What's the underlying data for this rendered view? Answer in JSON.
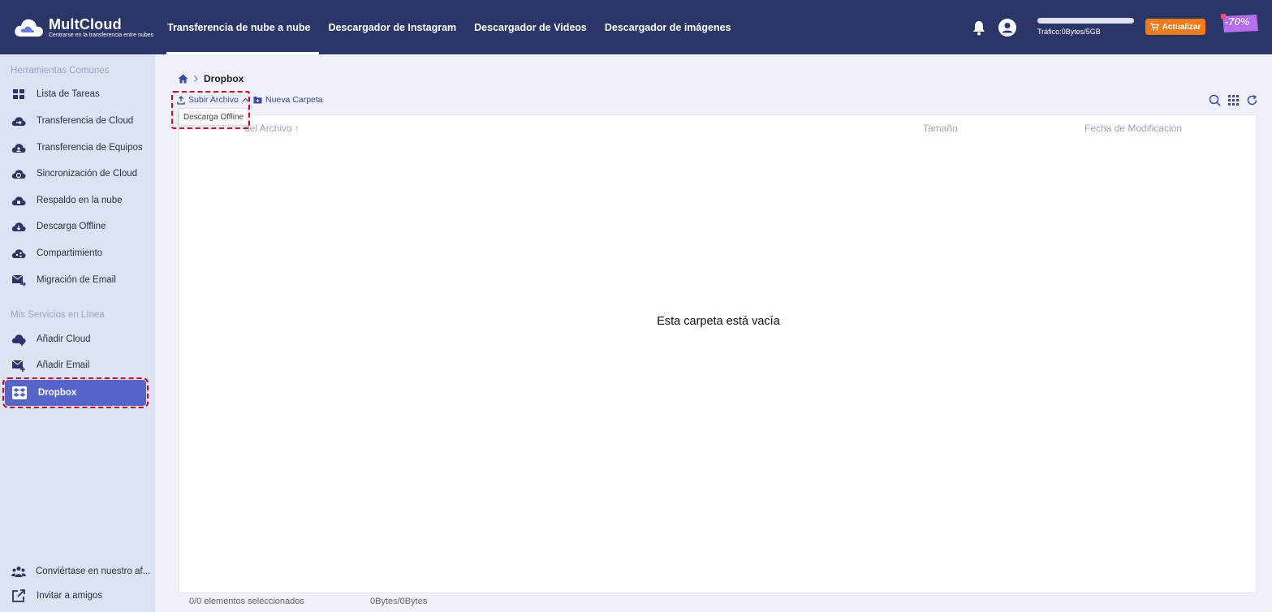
{
  "brand": {
    "name": "MultCloud",
    "tagline": "Centrarse en la transferencia entre nubes"
  },
  "nav": {
    "tabs": [
      {
        "label": "Transferencia de nube a nube",
        "active": true
      },
      {
        "label": "Descargador de Instagram",
        "active": false
      },
      {
        "label": "Descargador de Videos",
        "active": false
      },
      {
        "label": "Descargador de imágenes",
        "active": false
      }
    ]
  },
  "account": {
    "traffic_label": "Tráfico:0Bytes/5GB",
    "traffic_used_fraction": 0,
    "upgrade_label": "Actualizar",
    "promo_label": "-70%"
  },
  "sidebar": {
    "section_common": "Herramientas Comunes",
    "common_items": [
      {
        "label": "Lista de Tareas",
        "icon": "grid-icon"
      },
      {
        "label": "Transferencia de Cloud",
        "icon": "cloud-transfer-icon"
      },
      {
        "label": "Transferencia de Equipos",
        "icon": "team-transfer-icon"
      },
      {
        "label": "Sincronización de Cloud",
        "icon": "cloud-sync-icon"
      },
      {
        "label": "Respaldo en la nube",
        "icon": "cloud-backup-icon"
      },
      {
        "label": "Descarga Offline",
        "icon": "offline-download-icon"
      },
      {
        "label": "Compartimiento",
        "icon": "share-icon"
      },
      {
        "label": "Migración de Email",
        "icon": "email-migration-icon"
      }
    ],
    "section_services": "Mis Servicios en Línea",
    "service_items": [
      {
        "label": "Añadir Cloud",
        "icon": "add-cloud-icon"
      },
      {
        "label": "Añadir Email",
        "icon": "add-email-icon"
      },
      {
        "label": "Dropbox",
        "icon": "dropbox-icon",
        "active": true
      }
    ],
    "footer_items": [
      {
        "label": "Conviértase en nuestro af...",
        "icon": "affiliate-icon"
      },
      {
        "label": "Invitar a amigos",
        "icon": "invite-icon"
      }
    ]
  },
  "main": {
    "breadcrumb": {
      "current": "Dropbox"
    },
    "toolbar": {
      "upload_label": "Subir Archivo",
      "new_folder_label": "Nueva Carpeta",
      "dropdown_option": "Descarga Offline"
    },
    "columns": {
      "name": "del Archivo",
      "size": "Tamaño",
      "date": "Fecha de Modificación"
    },
    "empty_message": "Esta carpeta está vacía"
  },
  "status": {
    "selected": "0/0 elementos seleccionados",
    "size": "0Bytes/0Bytes"
  },
  "colors": {
    "header": "#2b3568",
    "sidebar": "#dde3f3",
    "accent": "#5765c9",
    "upgrade": "#f07b1a",
    "highlight": "#d0021b"
  }
}
